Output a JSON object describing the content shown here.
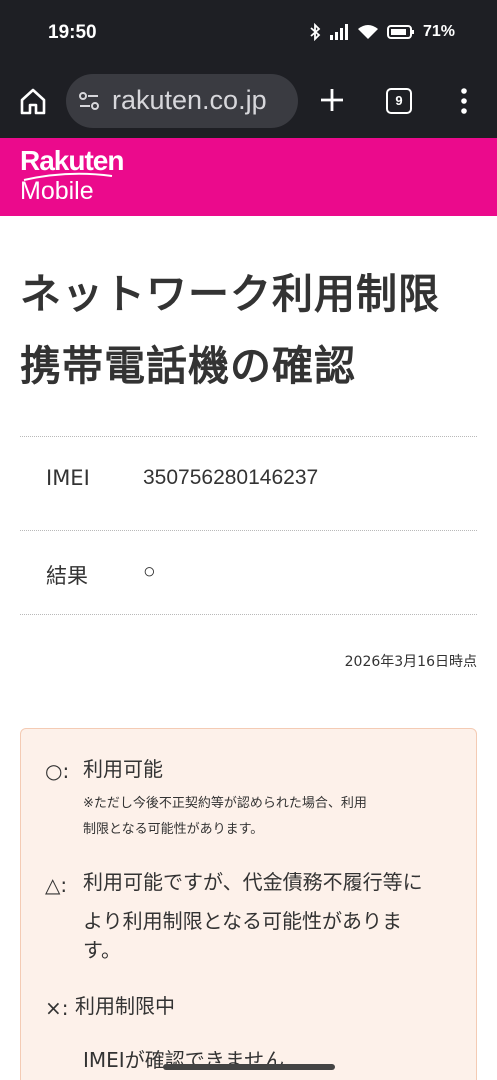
{
  "status_bar": {
    "time": "19:50",
    "battery": "71%"
  },
  "browser": {
    "url": "rakuten.co.jp",
    "tab_count": "9"
  },
  "brand": {
    "line1": "Rakuten",
    "line2": "Mobile"
  },
  "page": {
    "title_line1": "ネットワーク利用制限",
    "title_line2": "携帯電話機の確認"
  },
  "info": {
    "imei_label": "IMEI",
    "imei_value": "350756280146237",
    "result_label": "結果",
    "result_value": "○",
    "date": "2026年3月16日時点"
  },
  "legend": {
    "items": [
      {
        "symbol": "○:",
        "text": "利用可能",
        "note_line1": "※ただし今後不正契約等が認められた場合、利用",
        "note_line2": "制限となる可能性があります。"
      },
      {
        "symbol": "△:",
        "text_line1": "利用可能ですが、代金債務不履行等に",
        "text_line2": "より利用制限となる可能性がありま",
        "text_line3": "す。"
      },
      {
        "symbol": "×:",
        "text": "利用制限中"
      },
      {
        "partial_text": "IMEIが確認できません"
      }
    ]
  },
  "colors": {
    "brand": "#eb0a8c",
    "legend_bg": "#fdf1ea",
    "bar_bg": "#1e1f24"
  }
}
